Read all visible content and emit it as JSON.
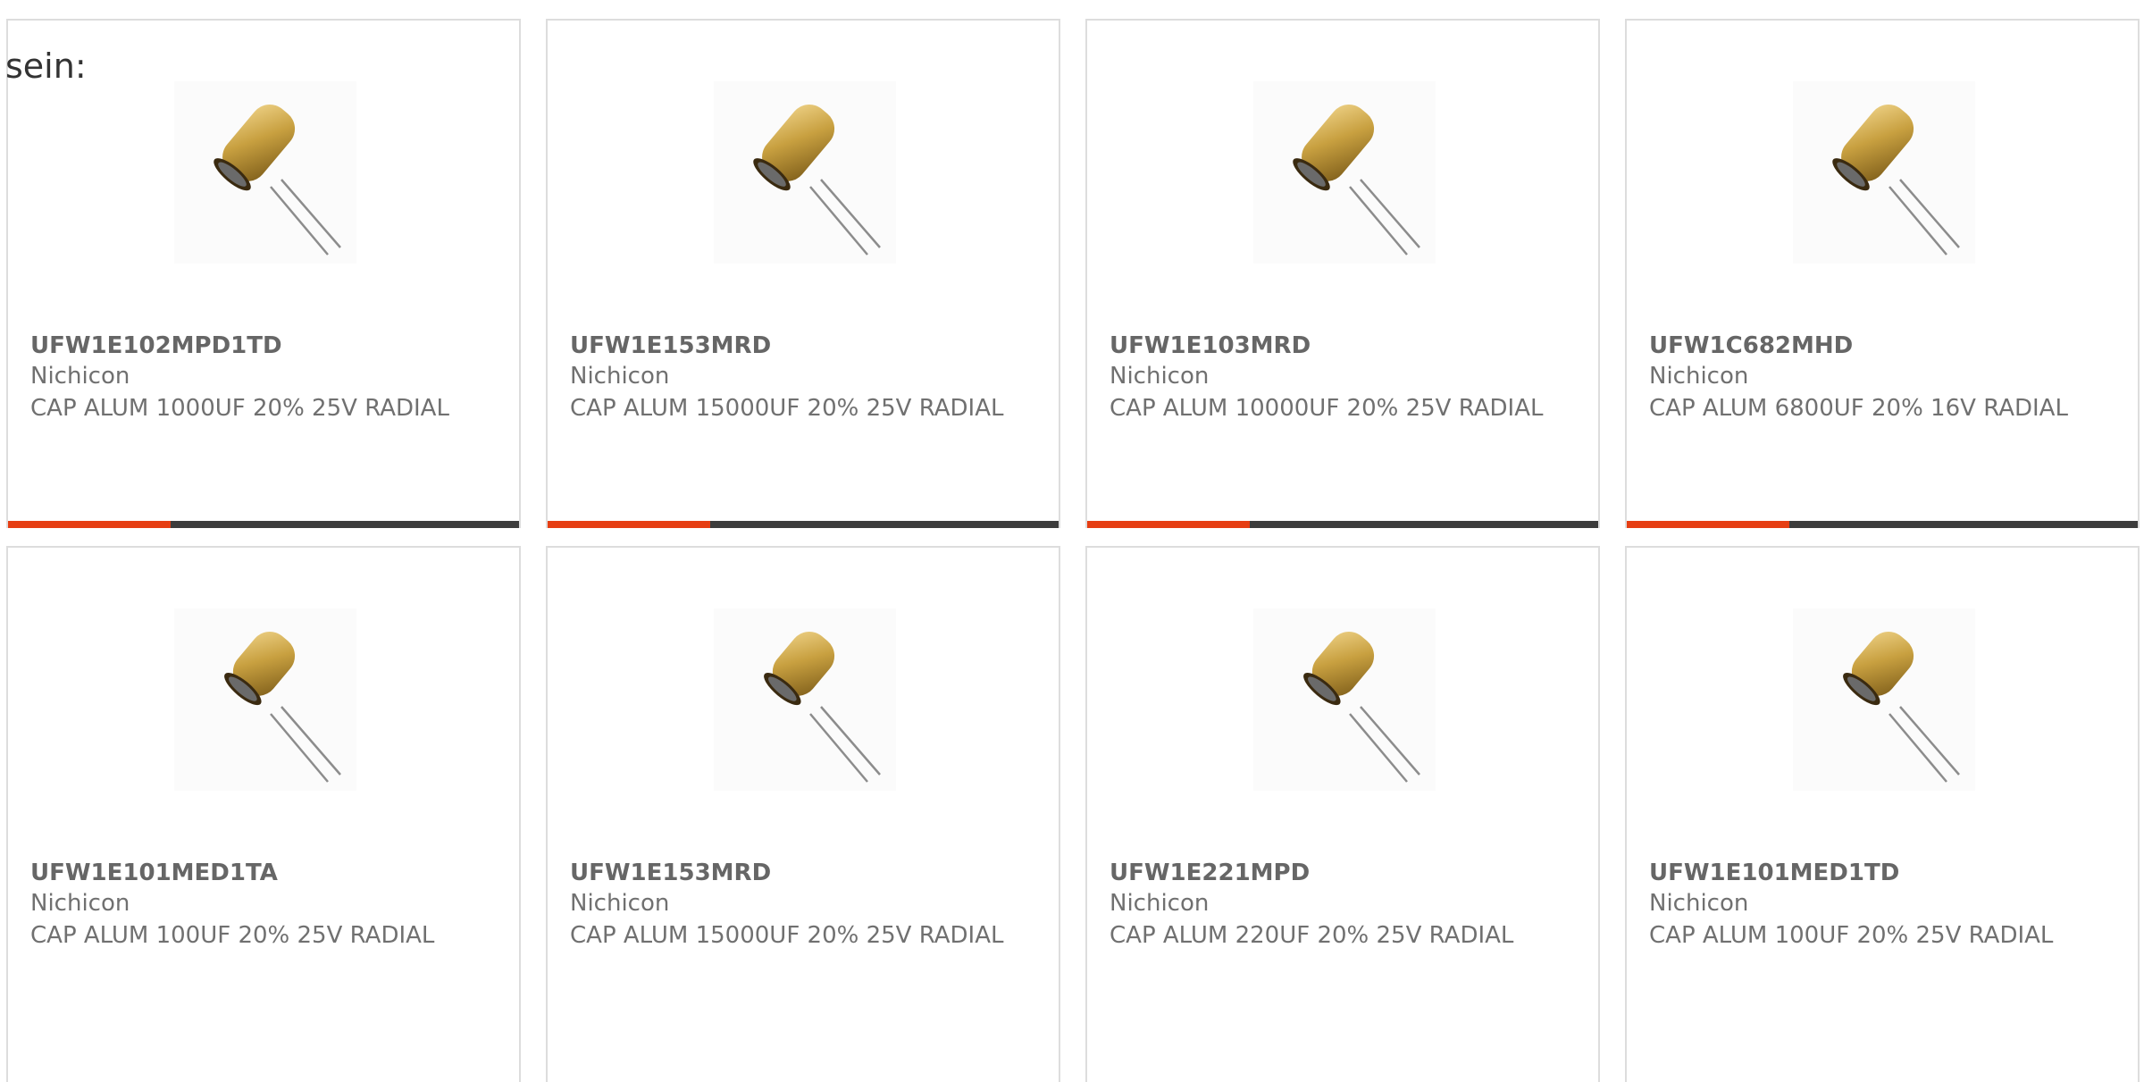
{
  "overflow_label": "sein:",
  "colors": {
    "accent": "#e63e13",
    "bar": "#3c3c3c",
    "border": "#dddddd"
  },
  "products": [
    {
      "part": "UFW1E102MPD1TD",
      "manufacturer": "Nichicon",
      "description": "CAP ALUM 1000UF 20% 25V RADIAL",
      "image": "capacitor-image"
    },
    {
      "part": "UFW1E153MRD",
      "manufacturer": "Nichicon",
      "description": "CAP ALUM 15000UF 20% 25V RADIAL",
      "image": "capacitor-image"
    },
    {
      "part": "UFW1E103MRD",
      "manufacturer": "Nichicon",
      "description": "CAP ALUM 10000UF 20% 25V RADIAL",
      "image": "capacitor-image"
    },
    {
      "part": "UFW1C682MHD",
      "manufacturer": "Nichicon",
      "description": "CAP ALUM 6800UF 20% 16V RADIAL",
      "image": "capacitor-image"
    },
    {
      "part": "UFW1E101MED1TA",
      "manufacturer": "Nichicon",
      "description": "CAP ALUM 100UF 20% 25V RADIAL",
      "image": "capacitor-image"
    },
    {
      "part": "UFW1E153MRD",
      "manufacturer": "Nichicon",
      "description": "CAP ALUM 15000UF 20% 25V RADIAL",
      "image": "capacitor-image"
    },
    {
      "part": "UFW1E221MPD",
      "manufacturer": "Nichicon",
      "description": "CAP ALUM 220UF 20% 25V RADIAL",
      "image": "capacitor-image"
    },
    {
      "part": "UFW1E101MED1TD",
      "manufacturer": "Nichicon",
      "description": "CAP ALUM 100UF 20% 25V RADIAL",
      "image": "capacitor-image"
    }
  ]
}
